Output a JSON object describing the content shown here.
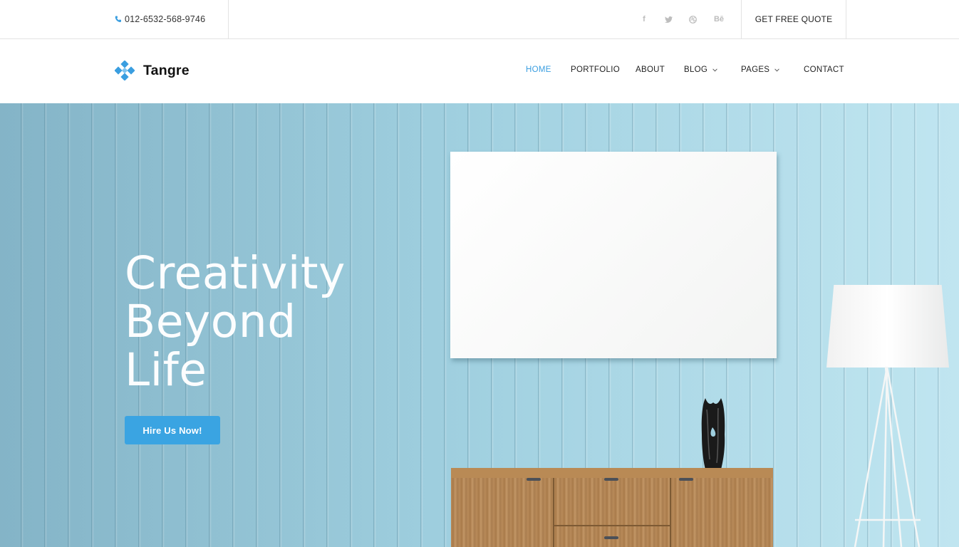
{
  "topbar": {
    "phone": "012-6532-568-9746",
    "socials": [
      {
        "icon": "facebook-icon",
        "glyph": "f"
      },
      {
        "icon": "twitter-icon",
        "glyph": "t"
      },
      {
        "icon": "dribbble-icon",
        "glyph": "◎"
      },
      {
        "icon": "behance-icon",
        "glyph": "Bē"
      }
    ],
    "quote_label": "GET FREE QUOTE"
  },
  "brand": {
    "name": "Tangre",
    "accent": "#3a9ee0"
  },
  "nav": {
    "items": [
      {
        "label": "HOME",
        "active": true,
        "dropdown": false
      },
      {
        "label": "PORTFOLIO",
        "active": false,
        "dropdown": false
      },
      {
        "label": "ABOUT",
        "active": false,
        "dropdown": false
      },
      {
        "label": "BLOG",
        "active": false,
        "dropdown": true
      },
      {
        "label": "PAGES",
        "active": false,
        "dropdown": true
      },
      {
        "label": "CONTACT",
        "active": false,
        "dropdown": false
      }
    ]
  },
  "hero": {
    "headline": [
      "Creativity",
      "Beyond",
      "Life"
    ],
    "cta_label": "Hire Us Now!",
    "cta_color": "#3aa4e2"
  }
}
